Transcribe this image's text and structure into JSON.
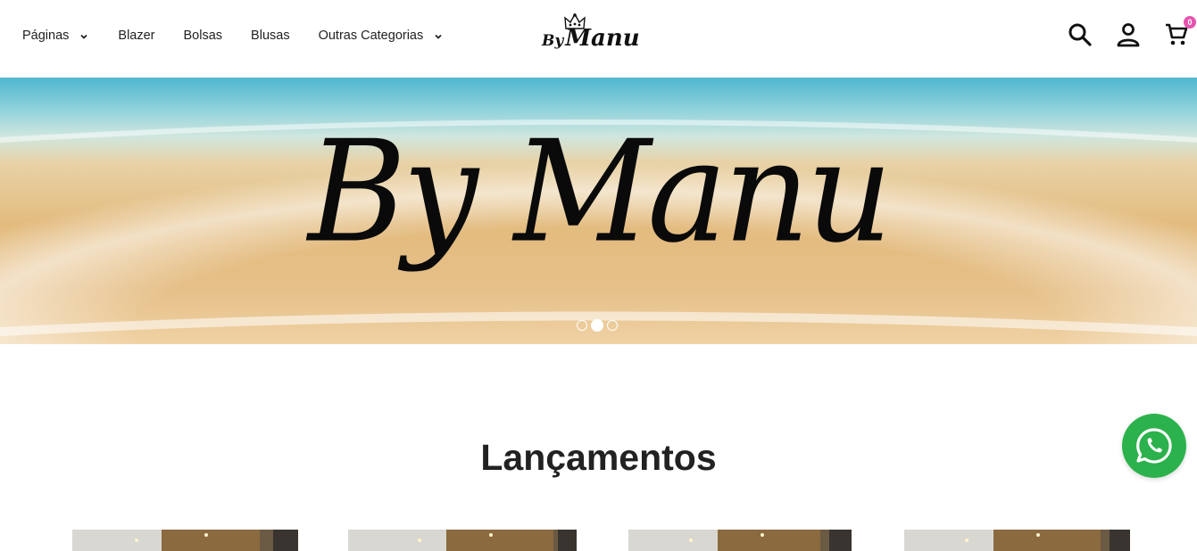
{
  "nav": {
    "items": [
      {
        "label": "Páginas",
        "has_dropdown": true
      },
      {
        "label": "Blazer",
        "has_dropdown": false
      },
      {
        "label": "Bolsas",
        "has_dropdown": false
      },
      {
        "label": "Blusas",
        "has_dropdown": false
      },
      {
        "label": "Outras Categorias",
        "has_dropdown": true
      }
    ]
  },
  "logo": {
    "by": "By",
    "manu": "Manu"
  },
  "header_icons": {
    "search": "search-icon",
    "account": "user-icon",
    "cart": "cart-icon",
    "cart_count": "0",
    "badge_color": "#e754b0"
  },
  "hero": {
    "title": "By Manu",
    "slides_total": 3,
    "active_slide": 2
  },
  "section": {
    "title": "Lançamentos"
  },
  "products": [
    {
      "name": "product-1"
    },
    {
      "name": "product-2"
    },
    {
      "name": "product-3"
    },
    {
      "name": "product-4"
    }
  ],
  "whatsapp": {
    "icon": "whatsapp-icon",
    "color": "#2bb24c"
  }
}
